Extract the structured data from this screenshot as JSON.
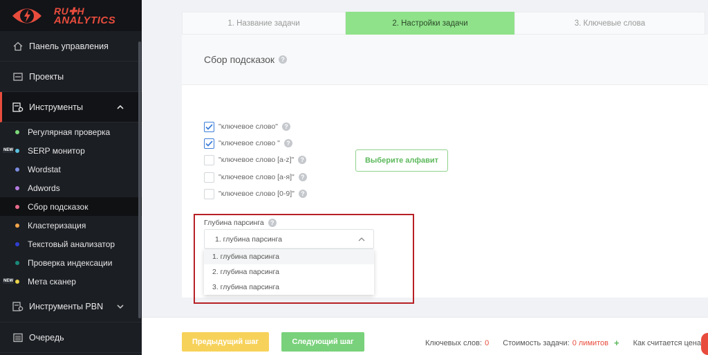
{
  "logo": {
    "line1": "RU✚H",
    "line2": "ANALYTICS"
  },
  "sidebar": {
    "main_items": [
      {
        "label": "Панель управления",
        "icon": "home-icon"
      },
      {
        "label": "Проекты",
        "icon": "projects-icon"
      },
      {
        "label": "Инструменты",
        "icon": "tools-icon"
      }
    ],
    "sub_items": [
      {
        "label": "Регулярная проверка",
        "dot": "#7dd87a",
        "badge": ""
      },
      {
        "label": "SERP монитор",
        "dot": "#5bc0de",
        "badge": "NEW"
      },
      {
        "label": "Wordstat",
        "dot": "#7b8ce0",
        "badge": ""
      },
      {
        "label": "Adwords",
        "dot": "#b47be0",
        "badge": ""
      },
      {
        "label": "Сбор подсказок",
        "dot": "#e86b8b",
        "badge": ""
      },
      {
        "label": "Кластеризация",
        "dot": "#f0a54a",
        "badge": ""
      },
      {
        "label": "Текстовый анализатор",
        "dot": "#2f3fd1",
        "badge": ""
      },
      {
        "label": "Проверка индексации",
        "dot": "#1a8a7a",
        "badge": ""
      },
      {
        "label": "Мета сканер",
        "dot": "#e8d14a",
        "badge": "NEW"
      }
    ],
    "pbn_label": "Инструменты PBN",
    "queue_label": "Очередь"
  },
  "tabs": [
    {
      "label": "1. Название задачи"
    },
    {
      "label": "2. Настройки задачи"
    },
    {
      "label": "3. Ключевые слова"
    }
  ],
  "panel": {
    "title": "Сбор подсказок",
    "checkboxes": [
      {
        "label": "\"ключевое слово\"",
        "checked": true
      },
      {
        "label": "\"ключевое слово \"",
        "checked": true
      },
      {
        "label": "\"ключевое слово [a-z]\"",
        "checked": false
      },
      {
        "label": "\"ключевое слово [а-я]\"",
        "checked": false
      },
      {
        "label": "\"ключевое слово [0-9]\"",
        "checked": false
      }
    ],
    "alphabet_button": "Выберите алфавит",
    "depth_label": "Глубина парсинга",
    "depth_selected": "1. глубина парсинга",
    "depth_options": [
      "1. глубина парсинга",
      "2. глубина парсинга",
      "3. глубина парсинга"
    ]
  },
  "footer": {
    "prev_button": "Предыдущий шаг",
    "next_button": "Следующий шаг",
    "keywords_label": "Ключевых слов:",
    "keywords_value": "0",
    "cost_label": "Стоимость задачи:",
    "cost_value": "0 лимитов",
    "price_link": "Как считается цена"
  },
  "colors": {
    "accent": "#e84c3d",
    "active_tab": "#8fe28a",
    "highlight_box": "#b72025"
  }
}
